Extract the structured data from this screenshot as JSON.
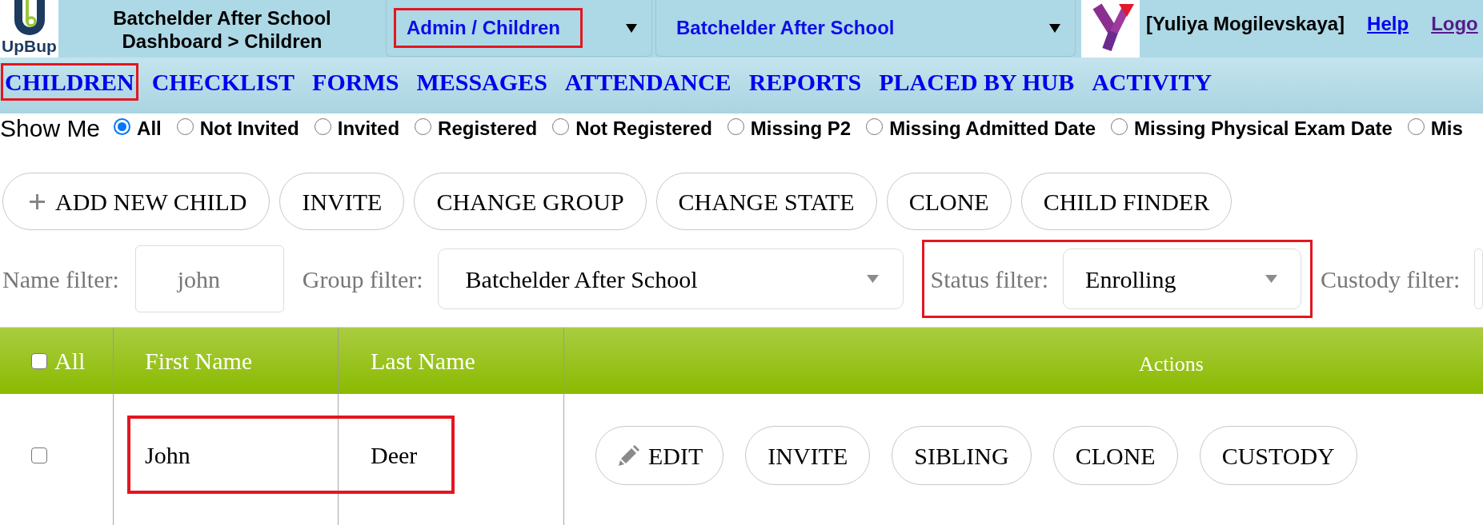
{
  "header": {
    "logo_text": "UpBup",
    "title": "Batchelder After School",
    "breadcrumb": "Dashboard > Children",
    "dropdowns": [
      {
        "value": "Admin / Children",
        "highlighted": true
      },
      {
        "value": "Batchelder After School",
        "highlighted": false
      }
    ],
    "user": "[Yuliya Mogilevskaya]",
    "links": [
      {
        "label": "Help",
        "visited": false
      },
      {
        "label": "Logo",
        "visited": true
      }
    ]
  },
  "nav": [
    {
      "label": "CHILDREN",
      "highlighted": true
    },
    {
      "label": "CHECKLIST",
      "highlighted": false
    },
    {
      "label": "FORMS",
      "highlighted": false
    },
    {
      "label": "MESSAGES",
      "highlighted": false
    },
    {
      "label": "ATTENDANCE",
      "highlighted": false
    },
    {
      "label": "REPORTS",
      "highlighted": false
    },
    {
      "label": "PLACED BY HUB",
      "highlighted": false
    },
    {
      "label": "ACTIVITY",
      "highlighted": false
    }
  ],
  "show_me": {
    "label": "Show Me",
    "options": [
      {
        "label": "All",
        "selected": true
      },
      {
        "label": "Not Invited",
        "selected": false
      },
      {
        "label": "Invited",
        "selected": false
      },
      {
        "label": "Registered",
        "selected": false
      },
      {
        "label": "Not Registered",
        "selected": false
      },
      {
        "label": "Missing P2",
        "selected": false
      },
      {
        "label": "Missing Admitted Date",
        "selected": false
      },
      {
        "label": "Missing Physical Exam Date",
        "selected": false
      },
      {
        "label": "Mis",
        "selected": false
      }
    ]
  },
  "toolbar": [
    {
      "label": "ADD NEW CHILD"
    },
    {
      "label": "INVITE"
    },
    {
      "label": "CHANGE GROUP"
    },
    {
      "label": "CHANGE STATE"
    },
    {
      "label": "CLONE"
    },
    {
      "label": "CHILD FINDER"
    }
  ],
  "filters": [
    {
      "kind": "text",
      "label": "Name filter:",
      "value": "john",
      "highlighted": false
    },
    {
      "kind": "select",
      "label": "Group filter:",
      "value": "Batchelder After School",
      "highlighted": false
    },
    {
      "kind": "select",
      "label": "Status filter:",
      "value": "Enrolling",
      "highlighted": true
    },
    {
      "kind": "select",
      "label": "Custody filter:",
      "highlighted": false
    }
  ],
  "table": {
    "columns": [
      {
        "kind": "checkbox",
        "label": "All",
        "checked": false
      },
      {
        "kind": "text",
        "label": "First Name"
      },
      {
        "kind": "text",
        "label": "Last Name"
      },
      {
        "kind": "actions",
        "label": "Actions"
      }
    ],
    "rows": [
      {
        "checked": false,
        "first_name": "John",
        "last_name": "Deer",
        "highlighted": true,
        "actions": [
          {
            "label": "EDIT"
          },
          {
            "label": "INVITE"
          },
          {
            "label": "SIBLING"
          },
          {
            "label": "CLONE"
          },
          {
            "label": "CUSTODY"
          }
        ]
      }
    ]
  }
}
